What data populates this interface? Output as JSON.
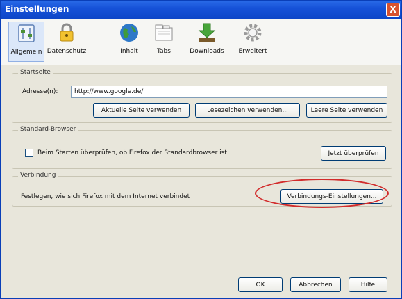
{
  "window": {
    "title": "Einstellungen",
    "close_glyph": "X"
  },
  "toolbar": {
    "items": [
      {
        "label": "Allgemein",
        "icon": "general-icon",
        "selected": true
      },
      {
        "label": "Datenschutz",
        "icon": "lock-icon"
      },
      {
        "label": "Inhalt",
        "icon": "globe-icon"
      },
      {
        "label": "Tabs",
        "icon": "tabs-icon"
      },
      {
        "label": "Downloads",
        "icon": "downloads-icon"
      },
      {
        "label": "Erweitert",
        "icon": "gear-icon"
      }
    ]
  },
  "startseite": {
    "title": "Startseite",
    "address_label": "Adresse(n):",
    "address_value": "http://www.google.de/",
    "buttons": [
      "Aktuelle Seite verwenden",
      "Lesezeichen verwenden...",
      "Leere Seite verwenden"
    ]
  },
  "standard_browser": {
    "title": "Standard-Browser",
    "checkbox_label": "Beim Starten überprüfen, ob Firefox der Standardbrowser ist",
    "check_button": "Jetzt überprüfen"
  },
  "verbindung": {
    "title": "Verbindung",
    "description": "Festlegen, wie sich Firefox mit dem Internet verbindet",
    "settings_button": "Verbindungs-Einstellungen..."
  },
  "footer": {
    "ok": "OK",
    "cancel": "Abbrechen",
    "help": "Hilfe"
  },
  "colors": {
    "titlebar": "#1652d8",
    "dialog_bg": "#e8e6db",
    "highlight_ellipse": "#d22b2b"
  }
}
